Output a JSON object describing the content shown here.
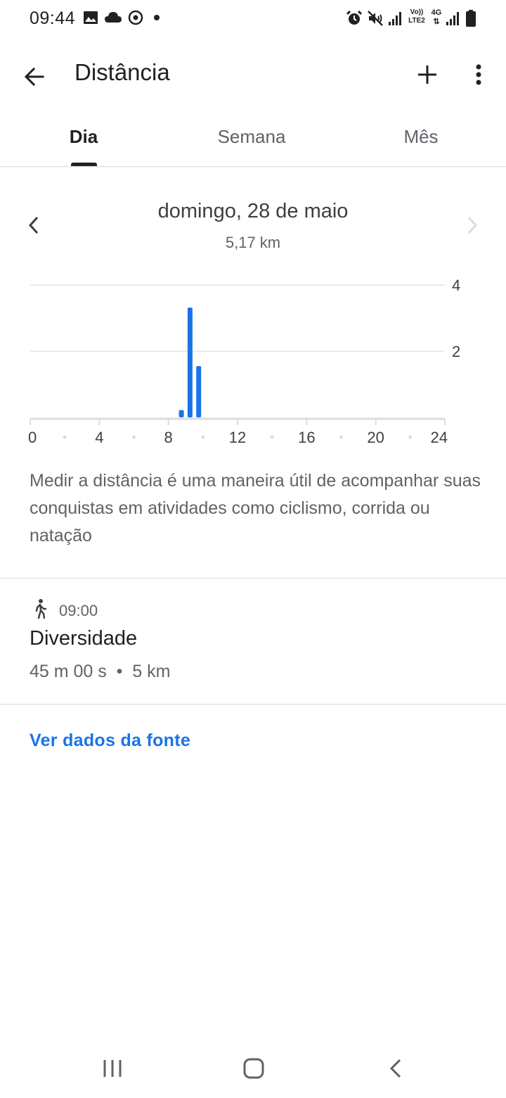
{
  "status_bar": {
    "time": "09:44",
    "icons_left": [
      "image-icon",
      "cloud-icon",
      "target-icon",
      "dot-icon"
    ],
    "icons_right": [
      "alarm-icon",
      "mute-icon",
      "signal-icon",
      "volte-icon",
      "4g-icon",
      "signal-icon",
      "battery-icon"
    ],
    "volte_text": "Vo)) LTE2",
    "net_text": "4G"
  },
  "app_bar": {
    "title": "Distância",
    "back_icon": "arrow-back-icon",
    "add_icon": "plus-icon",
    "more_icon": "more-vert-icon"
  },
  "tabs": [
    {
      "label": "Dia",
      "active": true
    },
    {
      "label": "Semana",
      "active": false
    },
    {
      "label": "Mês",
      "active": false
    }
  ],
  "day": {
    "date": "domingo, 28 de maio",
    "total": "5,17 km"
  },
  "chart_data": {
    "type": "bar",
    "x_ticks": [
      "0",
      "4",
      "8",
      "12",
      "16",
      "20",
      "24"
    ],
    "y_ticks": [
      "2",
      "4"
    ],
    "ylim": [
      0,
      4
    ],
    "xlim": [
      0,
      24
    ],
    "bars": [
      {
        "x": 8.75,
        "value": 0.22
      },
      {
        "x": 9.25,
        "value": 3.32
      },
      {
        "x": 9.75,
        "value": 1.55
      }
    ],
    "color": "#1a73e8",
    "grid": true
  },
  "description": "Medir a distância é uma maneira útil de acompanhar suas conquistas em atividades como ciclismo, corrida ou natação",
  "session": {
    "icon": "walking-icon",
    "time": "09:00",
    "title": "Diversidade",
    "details": "45 m 00 s  •  5 km"
  },
  "source_link": "Ver dados da fonte",
  "colors": {
    "accent": "#1a73e8",
    "text_primary": "#202124",
    "text_secondary": "#5f6368"
  }
}
